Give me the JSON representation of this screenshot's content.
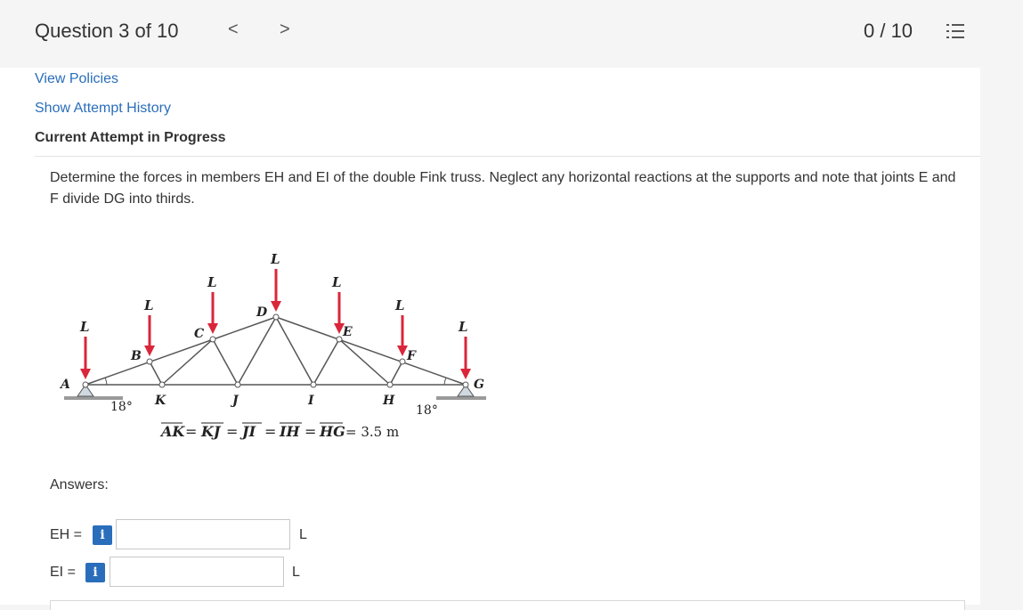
{
  "header": {
    "question_title": "Question 3 of 10",
    "prev_label": "<",
    "next_label": ">",
    "score": "0 / 10"
  },
  "links": {
    "view_policies": "View Policies",
    "show_attempt_history": "Show Attempt History"
  },
  "current_attempt": "Current Attempt in Progress",
  "question": {
    "prompt": "Determine the forces in members EH and EI of the double Fink truss. Neglect any horizontal reactions at the supports and note that joints E and F divide DG into thirds."
  },
  "figure": {
    "load_label": "L",
    "angle_left": "18°",
    "angle_right": "18°",
    "joints": {
      "A": "A",
      "B": "B",
      "C": "C",
      "D": "D",
      "E": "E",
      "F": "F",
      "G": "G",
      "H": "H",
      "I": "I",
      "J": "J",
      "K": "K"
    },
    "dimension_segments": [
      "AK",
      "KJ",
      "JI",
      "IH",
      "HG"
    ],
    "dimension_value": "= 3.5 m",
    "colors": {
      "load_arrow": "#d9263a",
      "member": "#555555",
      "ground": "#9a9a9a"
    }
  },
  "answers": {
    "label": "Answers:",
    "rows": [
      {
        "name": "EH =",
        "unit": "L",
        "value": ""
      },
      {
        "name": "EI =",
        "unit": "L",
        "value": ""
      }
    ],
    "info_icon": "i"
  },
  "icons": {
    "list_icon": "list-icon",
    "info_icon": "info-icon"
  },
  "colors": {
    "link": "#2a6ebb",
    "info_button": "#2a6ebb"
  }
}
